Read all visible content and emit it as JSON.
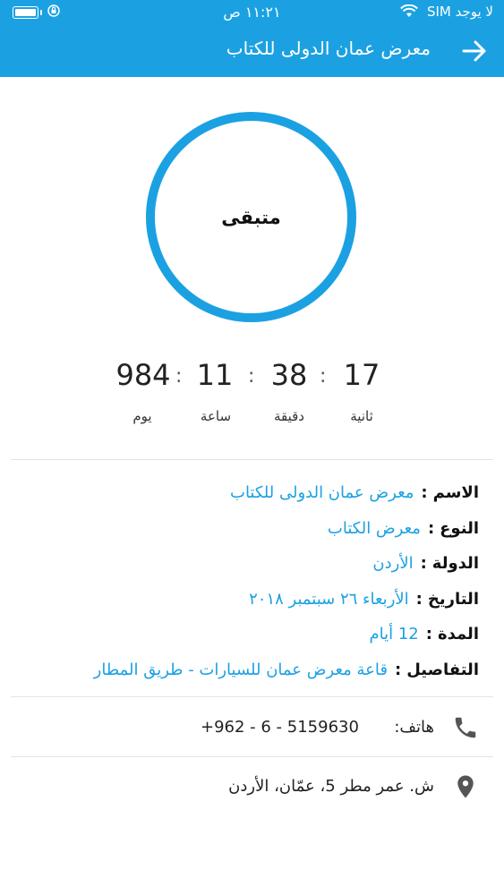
{
  "status_bar": {
    "carrier": "لا يوجد SIM",
    "time": "١١:٢١ ص",
    "lock_icon": "rotation-lock-icon",
    "battery_icon": "battery-icon",
    "wifi_icon": "wifi-icon"
  },
  "header": {
    "title": "معرض عمان الدولى للكتاب",
    "back_icon": "arrow-right-icon",
    "color": "#1ba1e2"
  },
  "countdown": {
    "label": "متبقى",
    "days": {
      "value": "984",
      "unit": "يوم"
    },
    "hours": {
      "value": "11",
      "unit": "ساعة"
    },
    "minutes": {
      "value": "38",
      "unit": "دقيقة"
    },
    "seconds": {
      "value": "17",
      "unit": "ثانية"
    },
    "separator": ":"
  },
  "details": [
    {
      "label": "الاسم",
      "value": "معرض عمان الدولى للكتاب"
    },
    {
      "label": "النوع",
      "value": "معرض الكتاب"
    },
    {
      "label": "الدولة",
      "value": "الأردن"
    },
    {
      "label": "التاريخ",
      "value": "الأربعاء ٢٦ سبتمبر ٢٠١٨"
    },
    {
      "label": "المدة",
      "value": "12 أيام"
    },
    {
      "label": "التفاصيل",
      "value": "قاعة معرض عمان للسيارات - طريق المطار"
    }
  ],
  "contact": {
    "phone_label": "هاتف:",
    "phone_value": "+962 - 6 - 5159630",
    "phone_icon": "phone-icon",
    "address": "ش. عمر مطر 5، عمّان، الأردن",
    "location_icon": "map-pin-icon"
  }
}
